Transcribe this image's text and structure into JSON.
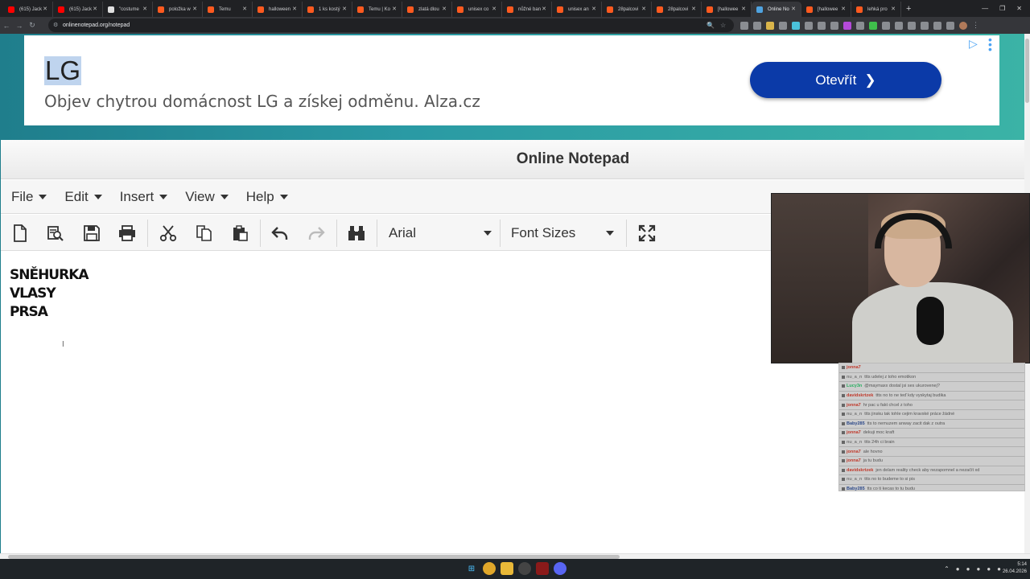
{
  "browser": {
    "tabs": [
      {
        "label": "(615) Jack",
        "icon": "youtube-icon",
        "color": "#ff0000"
      },
      {
        "label": "(615) Jack",
        "icon": "youtube-icon",
        "color": "#ff0000"
      },
      {
        "label": "\"costume",
        "icon": "google-icon",
        "color": "#e0e0e0"
      },
      {
        "label": "položka w",
        "icon": "temu-icon",
        "color": "#ff5a1f"
      },
      {
        "label": "Temu",
        "icon": "temu-icon",
        "color": "#ff5a1f"
      },
      {
        "label": "halloween",
        "icon": "temu-icon",
        "color": "#ff5a1f"
      },
      {
        "label": "1 ks kostý",
        "icon": "temu-icon",
        "color": "#ff5a1f"
      },
      {
        "label": "Temu | Ko",
        "icon": "temu-icon",
        "color": "#ff5a1f"
      },
      {
        "label": "zlatá dlou",
        "icon": "temu-icon",
        "color": "#ff5a1f"
      },
      {
        "label": "unisex co",
        "icon": "temu-icon",
        "color": "#ff5a1f"
      },
      {
        "label": "nůžné ban",
        "icon": "temu-icon",
        "color": "#ff5a1f"
      },
      {
        "label": "unisex an",
        "icon": "temu-icon",
        "color": "#ff5a1f"
      },
      {
        "label": "28palcovi",
        "icon": "temu-icon",
        "color": "#ff5a1f"
      },
      {
        "label": "28palcovi",
        "icon": "temu-icon",
        "color": "#ff5a1f"
      },
      {
        "label": "[hallowee",
        "icon": "temu-icon",
        "color": "#ff5a1f"
      },
      {
        "label": "Online No",
        "icon": "notepad-icon",
        "color": "#4fa3e0",
        "active": true
      },
      {
        "label": "[hallowee",
        "icon": "temu-icon",
        "color": "#ff5a1f"
      },
      {
        "label": "lehká pro",
        "icon": "temu-icon",
        "color": "#ff5a1f"
      }
    ],
    "new_tab": "+",
    "url": "onlinenotepad.org/notepad"
  },
  "ad": {
    "brand": "LG",
    "text": "Objev chytrou domácnost LG a získej odměnu. Alza.cz",
    "button_label": "Otevřít",
    "accent": "#0b3aa8"
  },
  "notepad": {
    "title": "Online Notepad",
    "menus": [
      "File",
      "Edit",
      "Insert",
      "View",
      "Help"
    ],
    "toolbar": {
      "font_family": "Arial",
      "font_size": "Font Sizes"
    },
    "content_lines": [
      "SNĚHURKA",
      "VLASY",
      "PRSA"
    ]
  },
  "chat": {
    "messages": [
      {
        "user": "jonna7",
        "text": "",
        "color": "#c0392b"
      },
      {
        "user": "nu_a_n",
        "text": "ttts udelej z toho emotikon",
        "color": "#7a7a7a"
      },
      {
        "user": "Lucy3n",
        "text": "@maymaxx dostal jsi ses ukurovenej?",
        "color": "#27ae60"
      },
      {
        "user": "davidskrtzek",
        "text": "ttts no to ne teď kdy vyskytaj budika",
        "color": "#c0392b"
      },
      {
        "user": "jonna7",
        "text": "hr pac u fakt chcel z toho",
        "color": "#c0392b"
      },
      {
        "user": "nu_a_n",
        "text": "ttts jinsku tak tohle cejim kravské práce žádné",
        "color": "#7a7a7a"
      },
      {
        "user": "Baby285",
        "text": "tts to nemuzem anway zacit dak z outra",
        "color": "#2e4a8a"
      },
      {
        "user": "jonna7",
        "text": "dekuji moc kraft",
        "color": "#c0392b"
      },
      {
        "user": "nu_a_n",
        "text": "ttts 24h ci brain",
        "color": "#7a7a7a"
      },
      {
        "user": "jonna7",
        "text": "ale hovno",
        "color": "#c0392b"
      },
      {
        "user": "jonna7",
        "text": "ja tu budu",
        "color": "#c0392b"
      },
      {
        "user": "davidskrtzek",
        "text": "jen delam reality check aby nezapomnel a nezačít xd",
        "color": "#c0392b"
      },
      {
        "user": "nu_a_n",
        "text": "ttts no to budeme to si pis",
        "color": "#7a7a7a"
      },
      {
        "user": "Baby285",
        "text": "tts co ti kecas to tu budu",
        "color": "#2e4a8a"
      }
    ]
  },
  "taskbar": {
    "time": "5:14",
    "date": "26.04.2026"
  }
}
